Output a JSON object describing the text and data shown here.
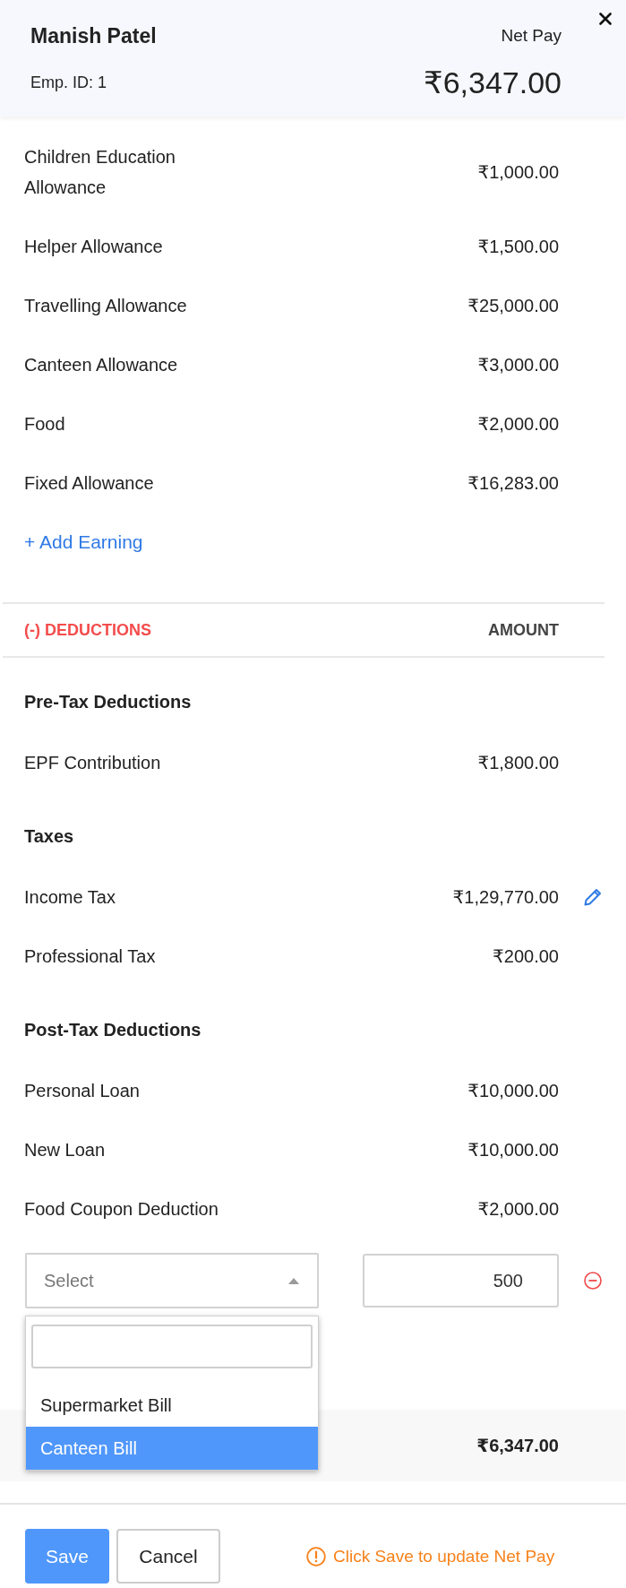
{
  "header": {
    "name": "Manish Patel",
    "emp_id": "Emp. ID: 1",
    "net_pay_label": "Net Pay",
    "net_pay": "₹6,347.00"
  },
  "earnings": {
    "rows": [
      {
        "name": "Children Education Allowance",
        "amount": "₹1,000.00",
        "editable": false
      },
      {
        "name": "Helper Allowance",
        "amount": "₹1,500.00",
        "editable": false
      },
      {
        "name": "Travelling Allowance",
        "amount": "₹25,000.00",
        "editable": false
      },
      {
        "name": "Canteen Allowance",
        "amount": "₹3,000.00",
        "editable": false
      },
      {
        "name": "Food",
        "amount": "₹2,000.00",
        "editable": false
      },
      {
        "name": "Fixed Allowance",
        "amount": "₹16,283.00",
        "editable": false
      }
    ],
    "add_link": "+ Add Earning"
  },
  "deductions": {
    "columns": [
      "(-) DEDUCTIONS",
      "AMOUNT"
    ],
    "groups": [
      {
        "title": "Pre-Tax Deductions",
        "rows": [
          {
            "name": "EPF Contribution",
            "amount": "₹1,800.00",
            "editable": false
          }
        ]
      },
      {
        "title": "Taxes",
        "rows": [
          {
            "name": "Income Tax",
            "amount": "₹1,29,770.00",
            "editable": true
          },
          {
            "name": "Professional Tax",
            "amount": "₹200.00",
            "editable": false
          }
        ]
      },
      {
        "title": "Post-Tax Deductions",
        "rows": [
          {
            "name": "Personal Loan",
            "amount": "₹10,000.00",
            "editable": false
          },
          {
            "name": "New Loan",
            "amount": "₹10,000.00",
            "editable": false
          },
          {
            "name": "Food Coupon Deduction",
            "amount": "₹2,000.00",
            "editable": false
          }
        ]
      }
    ]
  },
  "new_deduction": {
    "select": {
      "placeholder": "Select",
      "expanded": true
    },
    "amount": "500",
    "options": [
      {
        "label": "Supermarket Bill",
        "selected": false
      },
      {
        "label": "Canteen Bill",
        "selected": true
      }
    ]
  },
  "total": {
    "amount": "₹6,347.00"
  },
  "footer": {
    "buttons": [
      {
        "label": "Save",
        "kind": "primary"
      },
      {
        "label": "Cancel",
        "kind": "secondary"
      }
    ],
    "notice": "Click Save to update Net Pay"
  }
}
